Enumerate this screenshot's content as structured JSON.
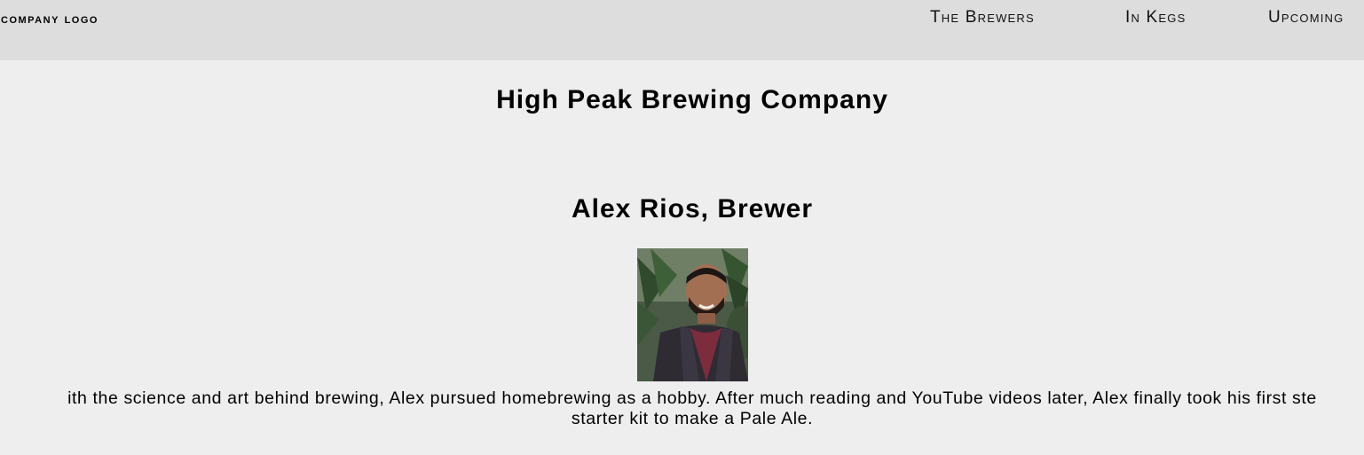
{
  "nav": {
    "logo": "COMPANY LOGO",
    "links": [
      "The Brewers",
      "In Kegs",
      "Upcoming"
    ]
  },
  "main": {
    "title": "High Peak Brewing Company",
    "brewer": {
      "name": "Alex Rios, Brewer",
      "photo_alt": "Alex Rios",
      "bio_line1": "ith the science and art behind brewing, Alex pursued homebrewing as a hobby. After much reading and YouTube videos later, Alex finally took his first ste",
      "bio_line2": "starter kit to make a Pale Ale."
    }
  },
  "colors": {
    "navbar_bg": "#dddddd",
    "page_bg": "#eeeeee",
    "text": "#000000"
  }
}
